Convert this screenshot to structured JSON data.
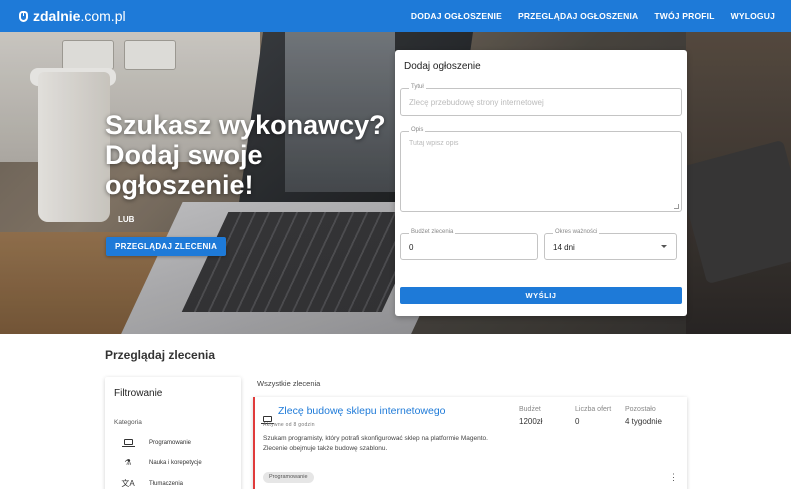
{
  "brand": {
    "name_bold": "zdalnie",
    "name_rest": ".com.pl",
    "icon": "mouse-icon"
  },
  "nav": {
    "items": [
      {
        "label": "DODAJ OGŁOSZENIE"
      },
      {
        "label": "PRZEGLĄDAJ OGŁOSZENIA"
      },
      {
        "label": "TWÓJ PROFIL"
      },
      {
        "label": "WYLOGUJ"
      }
    ]
  },
  "hero": {
    "title": "Szukasz wykonawcy? Dodaj swoje ogłoszenie!",
    "or_text": "LUB",
    "browse_button": "PRZEGLĄDAJ ZLECENIA"
  },
  "form": {
    "title": "Dodaj ogłoszenie",
    "title_field": {
      "label": "Tytuł",
      "placeholder": "Zlecę przebudowę strony internetowej",
      "value": ""
    },
    "description_field": {
      "label": "Opis",
      "placeholder": "Tutaj wpisz opis",
      "value": ""
    },
    "budget_field": {
      "label": "Budżet zlecenia",
      "value": "0"
    },
    "validity_field": {
      "label": "Okres ważności",
      "value": "14 dni"
    },
    "submit": "WYŚLIJ"
  },
  "browse": {
    "title": "Przeglądaj zlecenia",
    "filters": {
      "title": "Filtrowanie",
      "category_label": "Kategoria",
      "items": [
        {
          "label": "Programowanie",
          "icon": "laptop-icon"
        },
        {
          "label": "Nauka i korepetycje",
          "icon": "flask-icon"
        },
        {
          "label": "Tłumaczenia",
          "icon": "translate-icon"
        }
      ]
    },
    "list_header": "Wszystkie zlecenia",
    "jobs": [
      {
        "title": "Zlecę budowę sklepu internetowego",
        "active": "Aktywne od 8 godzin",
        "description": "Szukam programisty, który potrafi skonfigurować sklep na platformie Magento. Zlecenie obejmuje także budowę szablonu.",
        "budget_label": "Budżet",
        "budget_value": "1200zł",
        "offers_label": "Liczba ofert",
        "offers_value": "0",
        "left_label": "Pozostało",
        "left_value": "4 tygodnie",
        "tag": "Programowanie"
      }
    ]
  },
  "colors": {
    "primary": "#1e7ad8",
    "accent_border": "#e03b3b"
  }
}
